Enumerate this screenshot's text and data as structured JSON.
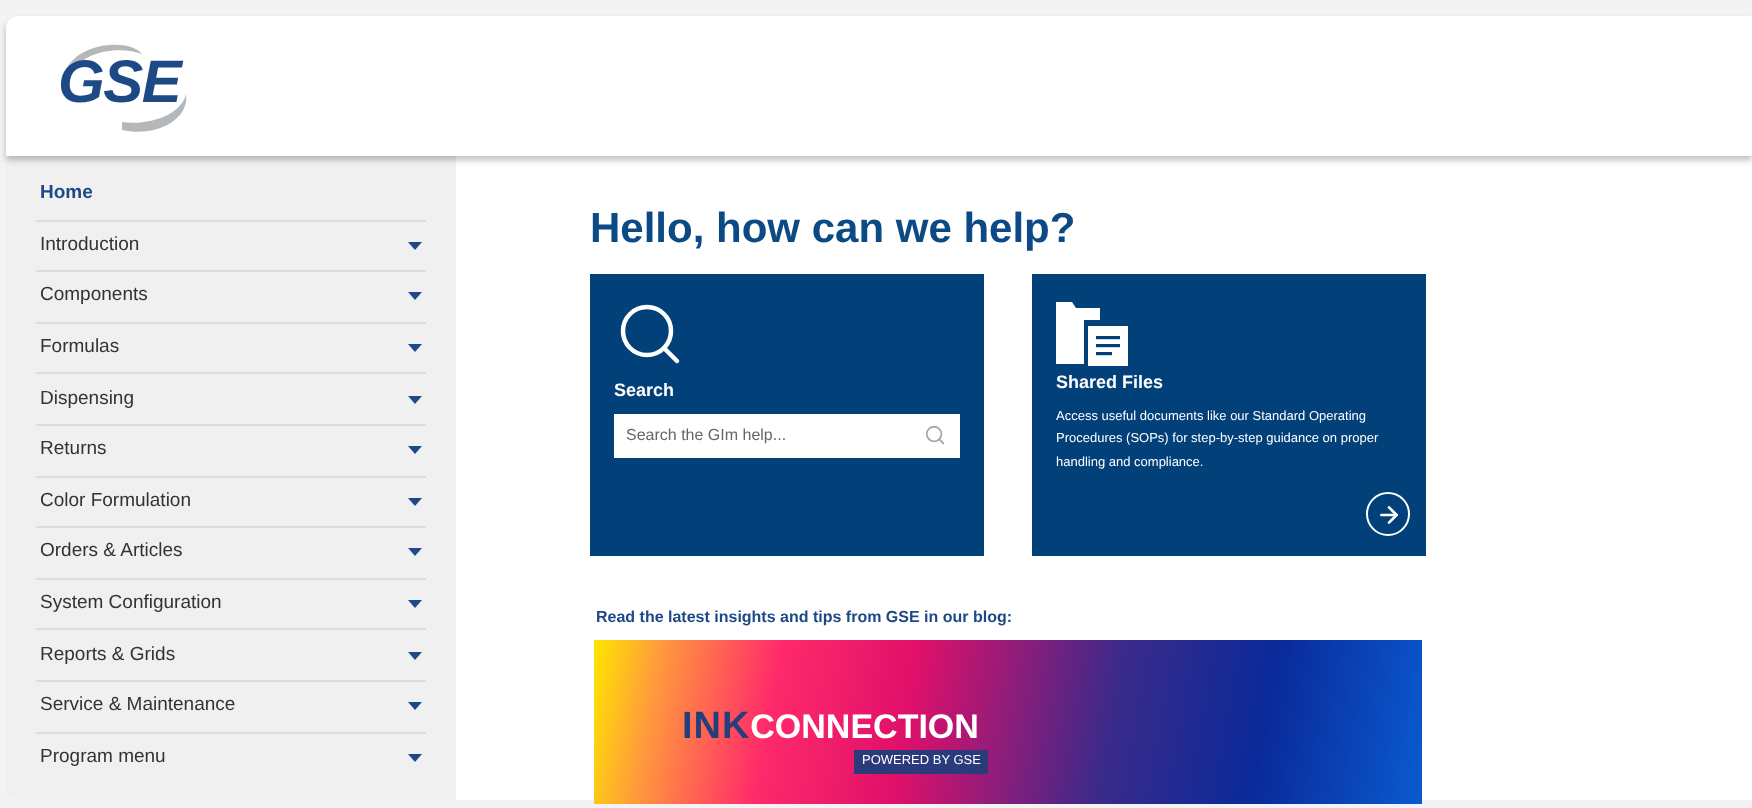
{
  "header": {
    "logo": "GSE"
  },
  "sidebar": {
    "items": [
      {
        "label": "Home",
        "selected": true,
        "has_submenu": false
      },
      {
        "label": "Introduction",
        "selected": false,
        "has_submenu": true
      },
      {
        "label": "Components",
        "selected": false,
        "has_submenu": true
      },
      {
        "label": "Formulas",
        "selected": false,
        "has_submenu": true
      },
      {
        "label": "Dispensing",
        "selected": false,
        "has_submenu": true
      },
      {
        "label": "Returns",
        "selected": false,
        "has_submenu": true
      },
      {
        "label": "Color Formulation",
        "selected": false,
        "has_submenu": true
      },
      {
        "label": "Orders & Articles",
        "selected": false,
        "has_submenu": true
      },
      {
        "label": "System Configuration",
        "selected": false,
        "has_submenu": true
      },
      {
        "label": "Reports & Grids",
        "selected": false,
        "has_submenu": true
      },
      {
        "label": "Service & Maintenance",
        "selected": false,
        "has_submenu": true
      },
      {
        "label": "Program menu",
        "selected": false,
        "has_submenu": true
      }
    ]
  },
  "main": {
    "heading": "Hello, how can we help?",
    "search_card": {
      "title": "Search",
      "placeholder": "Search the GIm help..."
    },
    "files_card": {
      "title": "Shared Files",
      "description": "Access useful documents like our Standard Operating Procedures (SOPs) for step-by-step guidance on proper handling and compliance."
    },
    "blog": {
      "intro": "Read the latest insights and tips from GSE in our blog:",
      "banner": {
        "word_1": "INK",
        "word_2": "CONNECTION",
        "tagline": "POWERED BY GSE"
      }
    }
  }
}
